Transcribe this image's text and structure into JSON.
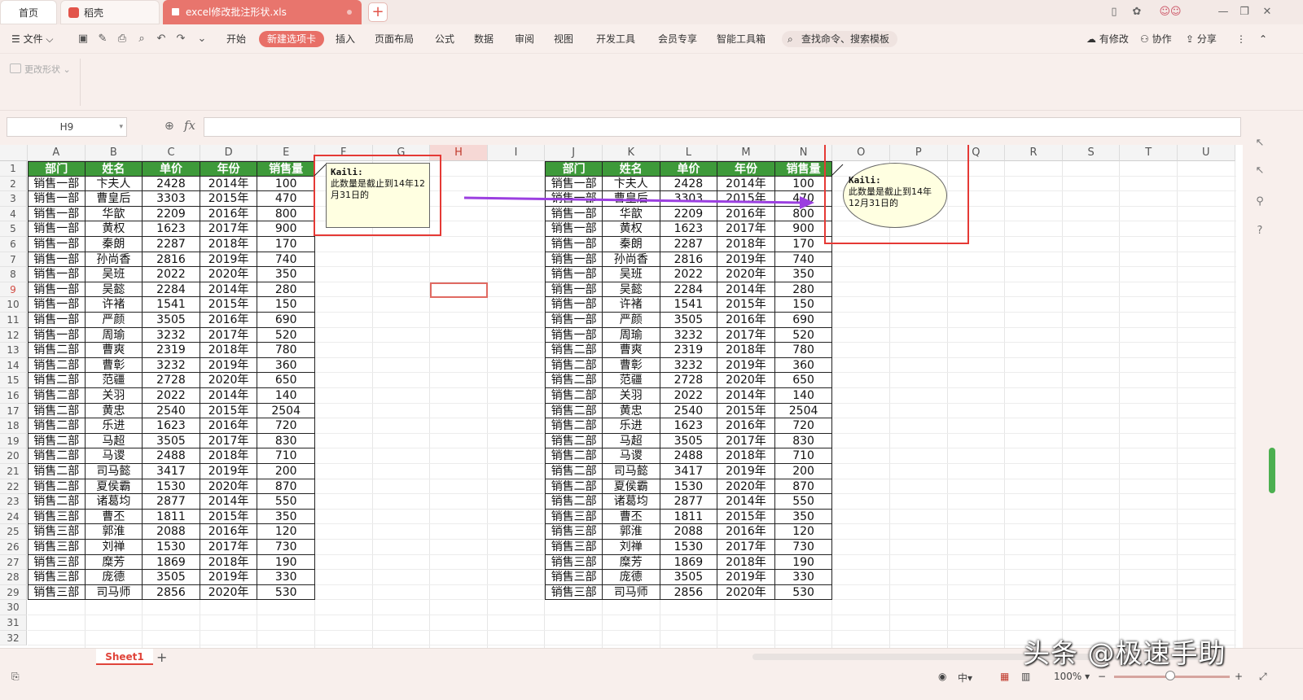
{
  "tabs": {
    "home": "首页",
    "daoke": "稻壳",
    "file": "excel修改批注形状.xls"
  },
  "menu": {
    "file": "文件",
    "items": [
      "开始",
      "新建选项卡",
      "插入",
      "页面布局",
      "公式",
      "数据",
      "审阅",
      "视图",
      "开发工具",
      "会员专享",
      "智能工具箱"
    ],
    "search": "查找命令、搜索模板",
    "modified": "有修改",
    "collab": "协作",
    "share": "分享"
  },
  "ribbon": {
    "change_shape": "更改形状"
  },
  "formula_bar": {
    "name_box": "H9",
    "fx": "fx",
    "value": ""
  },
  "columns": [
    "A",
    "B",
    "C",
    "D",
    "E",
    "F",
    "G",
    "H",
    "I",
    "J",
    "K",
    "L",
    "M",
    "N",
    "O",
    "P",
    "Q",
    "R",
    "S",
    "T",
    "U"
  ],
  "rows": [
    "1",
    "2",
    "3",
    "4",
    "5",
    "6",
    "7",
    "8",
    "9",
    "10",
    "11",
    "12",
    "13",
    "14",
    "15",
    "16",
    "17",
    "18",
    "19",
    "20",
    "21",
    "22",
    "23",
    "24",
    "25",
    "26",
    "27",
    "28",
    "29",
    "30",
    "31",
    "32"
  ],
  "selected_cell": "H9",
  "table_header": [
    "部门",
    "姓名",
    "单价",
    "年份",
    "销售量"
  ],
  "table_rows": [
    [
      "销售一部",
      "卞夫人",
      "2428",
      "2014年",
      "100"
    ],
    [
      "销售一部",
      "曹皇后",
      "3303",
      "2015年",
      "470"
    ],
    [
      "销售一部",
      "华歆",
      "2209",
      "2016年",
      "800"
    ],
    [
      "销售一部",
      "黄权",
      "1623",
      "2017年",
      "900"
    ],
    [
      "销售一部",
      "秦朗",
      "2287",
      "2018年",
      "170"
    ],
    [
      "销售一部",
      "孙尚香",
      "2816",
      "2019年",
      "740"
    ],
    [
      "销售一部",
      "吴班",
      "2022",
      "2020年",
      "350"
    ],
    [
      "销售一部",
      "吴懿",
      "2284",
      "2014年",
      "280"
    ],
    [
      "销售一部",
      "许褚",
      "1541",
      "2015年",
      "150"
    ],
    [
      "销售一部",
      "严颜",
      "3505",
      "2016年",
      "690"
    ],
    [
      "销售一部",
      "周瑜",
      "3232",
      "2017年",
      "520"
    ],
    [
      "销售二部",
      "曹爽",
      "2319",
      "2018年",
      "780"
    ],
    [
      "销售二部",
      "曹彰",
      "3232",
      "2019年",
      "360"
    ],
    [
      "销售二部",
      "范疆",
      "2728",
      "2020年",
      "650"
    ],
    [
      "销售二部",
      "关羽",
      "2022",
      "2014年",
      "140"
    ],
    [
      "销售二部",
      "黄忠",
      "2540",
      "2015年",
      "2504"
    ],
    [
      "销售二部",
      "乐进",
      "1623",
      "2016年",
      "720"
    ],
    [
      "销售二部",
      "马超",
      "3505",
      "2017年",
      "830"
    ],
    [
      "销售二部",
      "马谡",
      "2488",
      "2018年",
      "710"
    ],
    [
      "销售二部",
      "司马懿",
      "3417",
      "2019年",
      "200"
    ],
    [
      "销售二部",
      "夏侯霸",
      "1530",
      "2020年",
      "870"
    ],
    [
      "销售二部",
      "诸葛均",
      "2877",
      "2014年",
      "550"
    ],
    [
      "销售三部",
      "曹丕",
      "1811",
      "2015年",
      "350"
    ],
    [
      "销售三部",
      "郭淮",
      "2088",
      "2016年",
      "120"
    ],
    [
      "销售三部",
      "刘禅",
      "1530",
      "2017年",
      "730"
    ],
    [
      "销售三部",
      "糜芳",
      "1869",
      "2018年",
      "190"
    ],
    [
      "销售三部",
      "庞德",
      "3505",
      "2019年",
      "330"
    ],
    [
      "销售三部",
      "司马师",
      "2856",
      "2020年",
      "530"
    ]
  ],
  "comments": [
    {
      "author": "Kaili:",
      "text": "此数量是截止到14年12月31日的",
      "shape": "rectangle"
    },
    {
      "author": "Kaili:",
      "text": "此数量是截止到14年12月31日的",
      "shape": "oval"
    }
  ],
  "sheets": [
    "Sheet1"
  ],
  "status": {
    "zoom": "100%"
  },
  "watermark": "头条 @极速手助",
  "colors": {
    "header_green": "#3e9a3a",
    "accent": "#e86f67",
    "annotation_red": "#e53935",
    "arrow_purple": "#9b3fe0"
  }
}
